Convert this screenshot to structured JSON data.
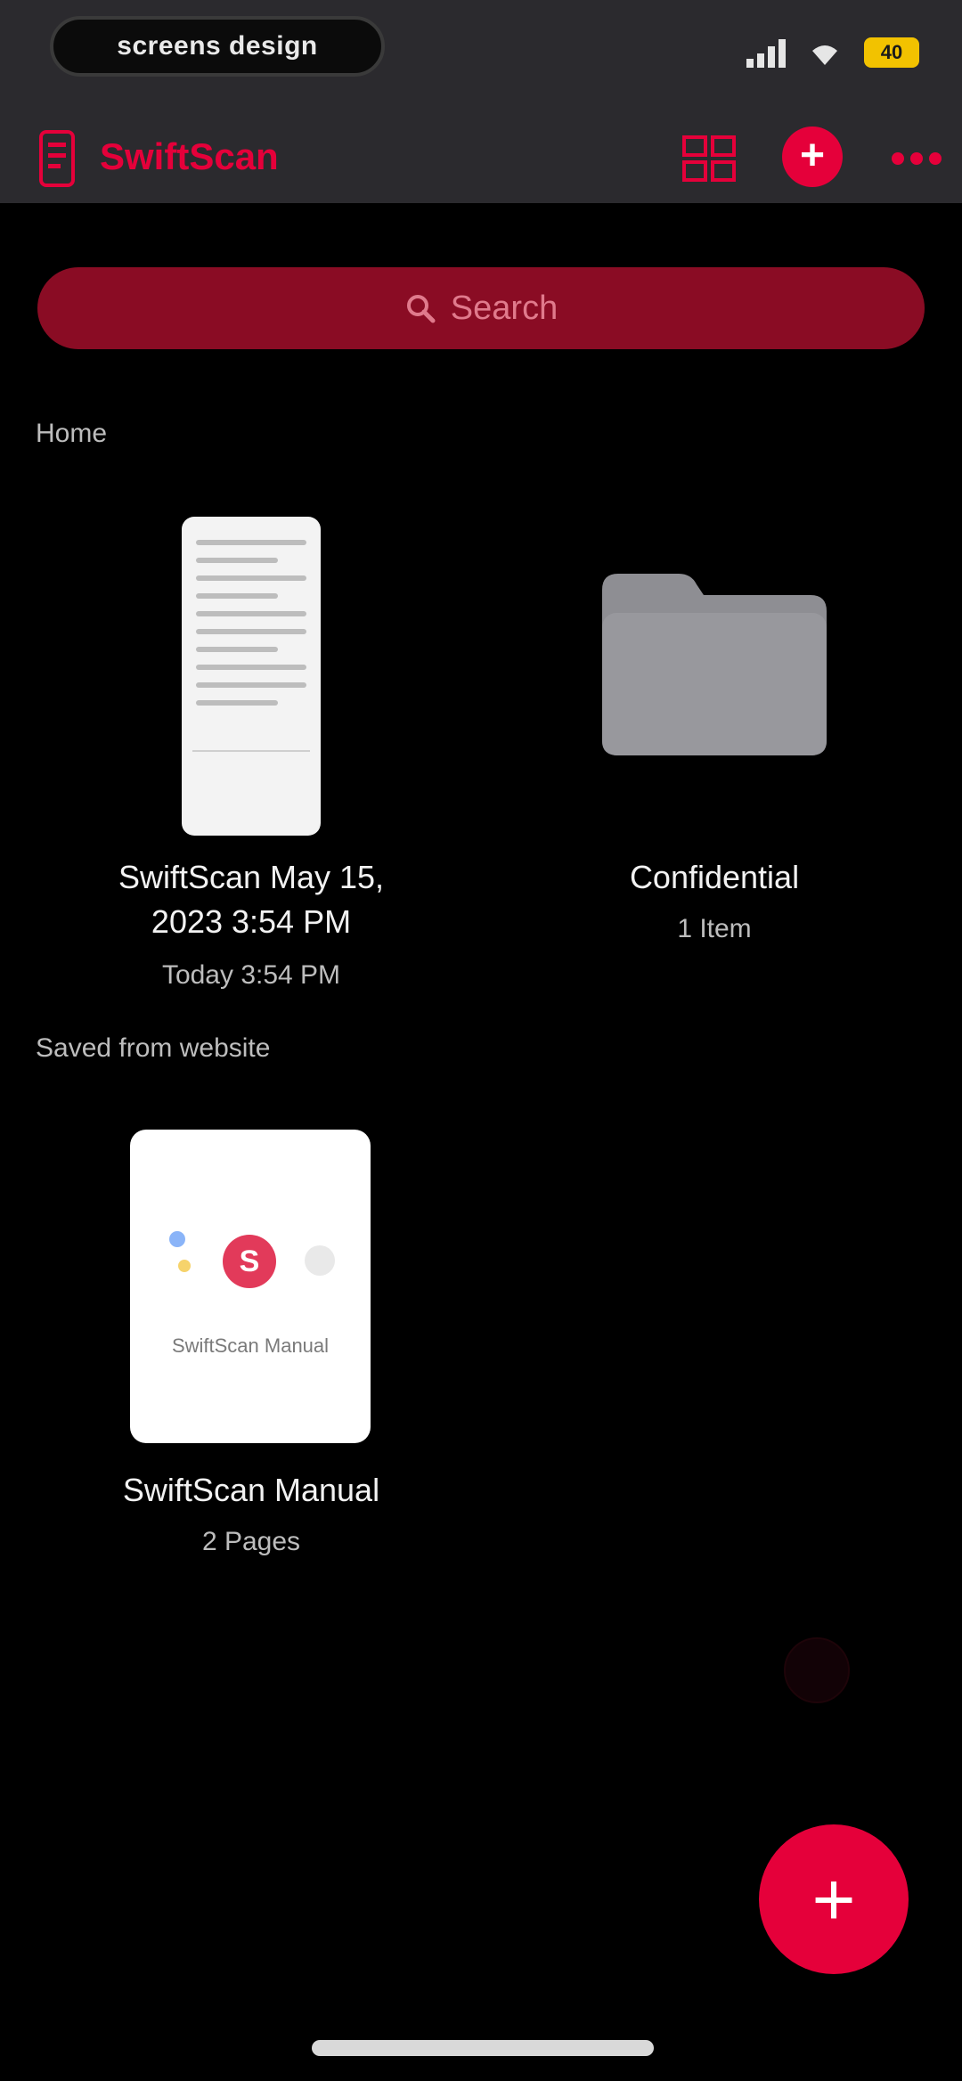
{
  "status_bar": {
    "recording_label": "screens design",
    "battery_label": "40",
    "colors": {
      "battery": "#f2c200"
    }
  },
  "header": {
    "title": "SwiftScan",
    "accent": "#e5003a",
    "icons": [
      "doc-logo-icon",
      "grid-icon",
      "plus-icon",
      "more-icon"
    ]
  },
  "search": {
    "placeholder": "Search",
    "bg": "#8a0c24"
  },
  "sections": [
    {
      "title": "Home",
      "items": [
        {
          "type": "document",
          "title_line1": "SwiftScan May 15,",
          "title_line2": "2023 3:54 PM",
          "subtitle": "Today 3:54 PM"
        },
        {
          "type": "folder",
          "title_line1": "Confidential",
          "subtitle": "1 Item"
        }
      ]
    },
    {
      "title": "Saved from website",
      "items": [
        {
          "type": "document",
          "title_line1": "SwiftScan Manual",
          "subtitle": "2 Pages",
          "thumb_label": "SwiftScan Manual"
        }
      ]
    }
  ],
  "fab": {
    "label": "+"
  }
}
